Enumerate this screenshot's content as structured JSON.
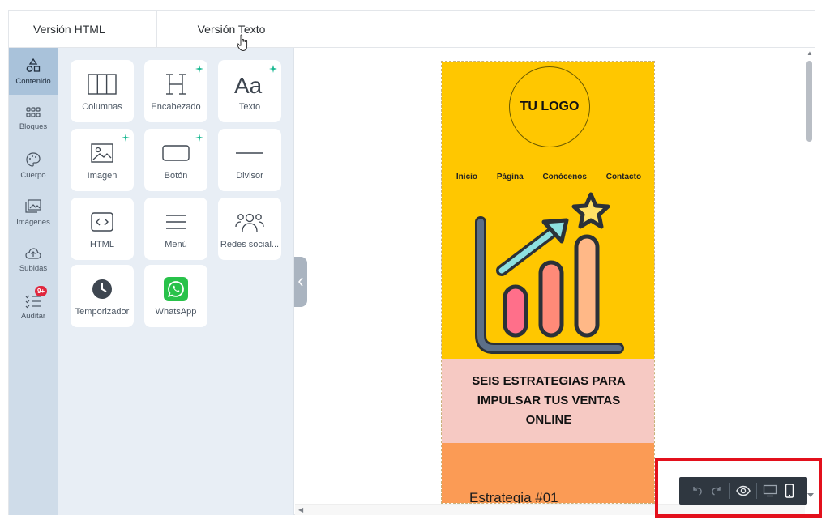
{
  "tabs": [
    {
      "label": "Versión HTML"
    },
    {
      "label": "Versión Texto"
    }
  ],
  "rail": {
    "items": [
      {
        "label": "Contenido",
        "icon": "shapes-icon",
        "active": true
      },
      {
        "label": "Bloques",
        "icon": "grid-icon"
      },
      {
        "label": "Cuerpo",
        "icon": "palette-icon"
      },
      {
        "label": "Imágenes",
        "icon": "images-icon"
      },
      {
        "label": "Subidas",
        "icon": "cloud-upload-icon"
      },
      {
        "label": "Auditar",
        "icon": "checklist-icon",
        "badge": "9+"
      }
    ]
  },
  "tools": [
    {
      "label": "Columnas",
      "icon": "columns-icon"
    },
    {
      "label": "Encabezado",
      "icon": "heading-icon",
      "ai": true
    },
    {
      "label": "Texto",
      "icon": "text-icon",
      "ai": true
    },
    {
      "label": "Imagen",
      "icon": "image-icon",
      "ai": true
    },
    {
      "label": "Botón",
      "icon": "button-icon",
      "ai": true
    },
    {
      "label": "Divisor",
      "icon": "divider-icon"
    },
    {
      "label": "HTML",
      "icon": "code-icon"
    },
    {
      "label": "Menú",
      "icon": "menu-icon"
    },
    {
      "label": "Redes social...",
      "icon": "social-icon"
    },
    {
      "label": "Temporizador",
      "icon": "clock-icon"
    },
    {
      "label": "WhatsApp",
      "icon": "whatsapp-icon"
    }
  ],
  "email": {
    "logo": "TU LOGO",
    "nav": [
      "Inicio",
      "Página",
      "Conócenos",
      "Contacto"
    ],
    "title": "SEIS ESTRATEGIAS PARA IMPULSAR TUS VENTAS ONLINE",
    "strategy": "Estrategia #01"
  },
  "toolbar": {
    "buttons": [
      "undo-icon",
      "redo-icon",
      "eye-icon",
      "desktop-icon",
      "mobile-icon"
    ]
  },
  "colors": {
    "rail_bg": "#cfdce9",
    "rail_active": "#a9c2da",
    "panel_bg": "#e8eef5",
    "hero_yellow": "#ffc700",
    "title_pink": "#f6c9c3",
    "orange": "#fb9b55",
    "highlight_red": "#e3101c",
    "toolbar_dark": "#2f3740"
  }
}
